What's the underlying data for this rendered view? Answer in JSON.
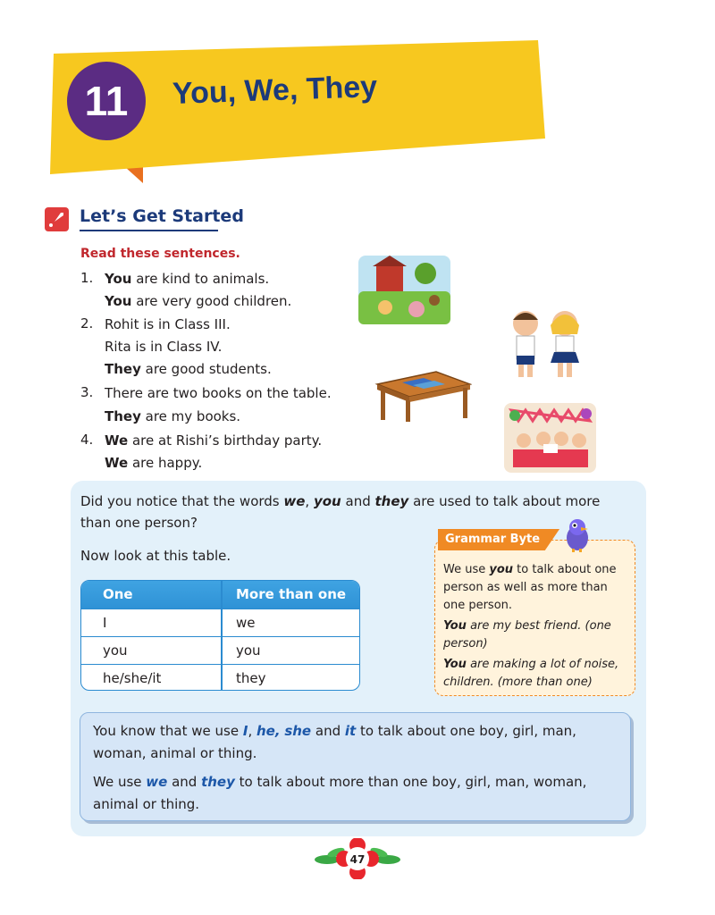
{
  "chapter": {
    "number": "11",
    "title": "You, We, They"
  },
  "section": {
    "title": "Let’s Get Started"
  },
  "exercise": {
    "heading": "Read these sentences.",
    "items": [
      {
        "num": "1.",
        "lines": [
          {
            "bold": "You",
            "rest": " are kind to animals."
          },
          {
            "bold": "You",
            "rest": " are very good children."
          }
        ]
      },
      {
        "num": "2.",
        "lines": [
          {
            "bold": "",
            "rest": "Rohit is in Class III."
          },
          {
            "bold": "",
            "rest": "Rita is in Class IV."
          },
          {
            "bold": "They",
            "rest": " are good students."
          }
        ]
      },
      {
        "num": "3.",
        "lines": [
          {
            "bold": "",
            "rest": "There are two books on the table."
          },
          {
            "bold": "They",
            "rest": " are my books."
          }
        ]
      },
      {
        "num": "4.",
        "lines": [
          {
            "bold": "We",
            "rest": " are at Rishi’s birthday party."
          },
          {
            "bold": "We",
            "rest": " are happy."
          }
        ]
      }
    ]
  },
  "panel": {
    "notice": {
      "p1": "Did you notice that the words ",
      "w1": "we",
      "c1": ", ",
      "w2": "you",
      "c2": " and ",
      "w3": "they",
      "p2": " are used to talk about more",
      "line2": "than one person?"
    },
    "look": "Now look at this table."
  },
  "table": {
    "headers": [
      "One",
      "More than one"
    ],
    "rows": [
      [
        "I",
        "we"
      ],
      [
        "you",
        "you"
      ],
      [
        "he/she/it",
        "they"
      ]
    ]
  },
  "grammar_byte": {
    "label": "Grammar Byte",
    "l1a": "We use ",
    "l1b": "you",
    "l1c": " to talk about one",
    "l2": "person as well as more than",
    "l3": "one person.",
    "ex1a": "You",
    "ex1b": " are my best friend. (one",
    "ex1c": "person)",
    "ex2a": "You",
    "ex2b": " are making a lot of noise,",
    "ex2c": "children. (more than one)"
  },
  "note": {
    "a1": "You know that we use ",
    "w1": "I",
    "c1": ", ",
    "w2": "he,",
    "c2": " ",
    "w3": "she",
    "c3": " and ",
    "w4": "it",
    "a2": " to talk about one boy, girl, man,",
    "a3": "woman, animal or thing.",
    "b1": "We use ",
    "bw1": "we",
    "b2": " and ",
    "bw2": "they",
    "b3": " to talk about more than one boy, girl, man, woman,",
    "b4": "animal or thing."
  },
  "page_number": "47",
  "colors": {
    "banner": "#f7c81f",
    "chapter_circle": "#5b2c83",
    "title": "#1c3a7a",
    "accent_red": "#c0272d",
    "table_blue": "#2f92d6",
    "panel": "#e3f1fa",
    "grammar_orange": "#f08a24"
  }
}
